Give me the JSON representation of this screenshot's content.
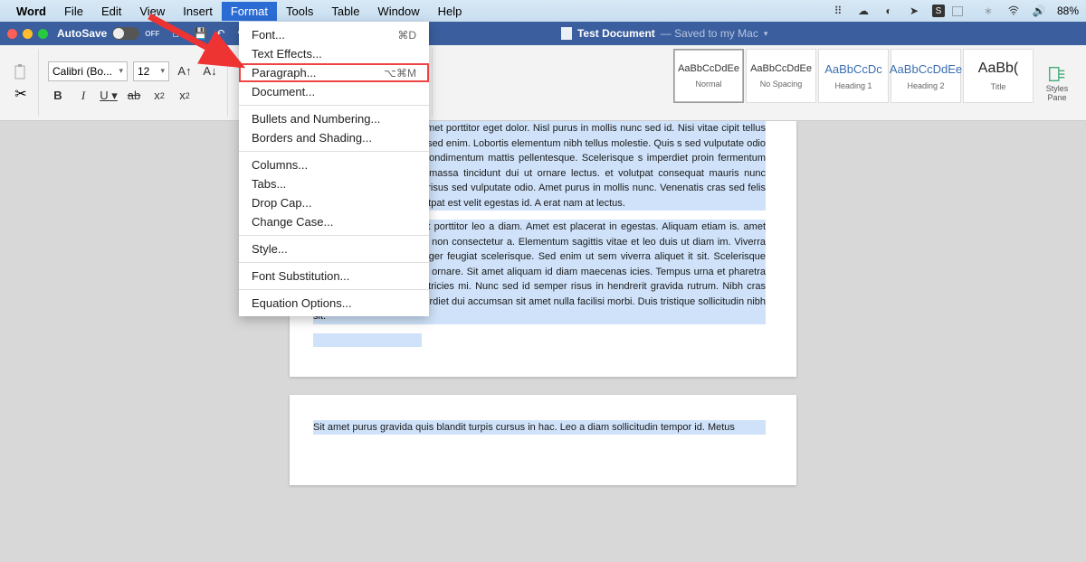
{
  "menubar": {
    "app": "Word",
    "items": [
      "File",
      "Edit",
      "View",
      "Insert",
      "Format",
      "Tools",
      "Table",
      "Window",
      "Help"
    ],
    "active": "Format",
    "battery": "88%"
  },
  "titlebar": {
    "autosave_label": "AutoSave",
    "autosave_state": "OFF",
    "doc_title": "Test Document",
    "doc_subtitle": "— Saved to my Mac"
  },
  "ribbon": {
    "font_name": "Calibri (Bo...",
    "font_size": "12",
    "styles": [
      {
        "preview": "AaBbCcDdEe",
        "label": "Normal",
        "cls": ""
      },
      {
        "preview": "AaBbCcDdEe",
        "label": "No Spacing",
        "cls": ""
      },
      {
        "preview": "AaBbCcDc",
        "label": "Heading 1",
        "cls": "heading"
      },
      {
        "preview": "AaBbCcDdEe",
        "label": "Heading 2",
        "cls": "heading"
      },
      {
        "preview": "AaBb(",
        "label": "Title",
        "cls": "title"
      }
    ],
    "styles_pane": "Styles\nPane"
  },
  "format_menu": {
    "groups": [
      [
        {
          "label": "Font...",
          "shortcut": "⌘D"
        },
        {
          "label": "Text Effects..."
        },
        {
          "label": "Paragraph...",
          "shortcut": "⌥⌘M",
          "highlight": true
        },
        {
          "label": "Document..."
        }
      ],
      [
        {
          "label": "Bullets and Numbering..."
        },
        {
          "label": "Borders and Shading..."
        }
      ],
      [
        {
          "label": "Columns..."
        },
        {
          "label": "Tabs..."
        },
        {
          "label": "Drop Cap..."
        },
        {
          "label": "Change Case..."
        }
      ],
      [
        {
          "label": "Style..."
        }
      ],
      [
        {
          "label": "Font Substitution..."
        }
      ],
      [
        {
          "label": "Equation Options..."
        }
      ]
    ]
  },
  "doc": {
    "p1": "cibus a pellentesque sit amet porttitor eget dolor. Nisl purus in mollis nunc sed id. Nisi vitae cipit tellus mauris a diam maecenas sed enim. Lobortis elementum nibh tellus molestie. Quis s sed vulputate odio ut enim blandit. At urna condimentum mattis pellentesque. Scelerisque s imperdiet proin fermentum leo vel. In cursus turpis massa tincidunt dui ut ornare lectus. et volutpat consequat mauris nunc congue nisi vitae. At quis risus sed vulputate odio. Amet purus in mollis nunc. Venenatis cras sed felis eget velit. Vel facilisis volutpat est velit egestas id. A erat nam at lectus.",
    "p2": "ta lorem mollis aliquam ut porttitor leo a diam. Amet est placerat in egestas. Aliquam etiam is. amet velit scelerisque in dictum non consectetur a. Elementum sagittis vitae et leo duis ut diam im. Viverra adipiscing at in tellus integer feugiat scelerisque. Sed enim ut sem viverra aliquet it sit. Scelerisque fermentum dui faucibus in ornare. Sit amet aliquam id diam maecenas icies. Tempus urna et pharetra pharetra massa massa ultricies mi. Nunc sed id semper risus in hendrerit gravida rutrum. Nibh cras pulvinar mattis nunc. Imperdiet dui accumsan sit amet nulla facilisi morbi. Duis tristique sollicitudin nibh sit.",
    "p3": "Sit amet purus gravida quis blandit turpis cursus in hac. Leo a diam sollicitudin tempor id. Metus"
  }
}
